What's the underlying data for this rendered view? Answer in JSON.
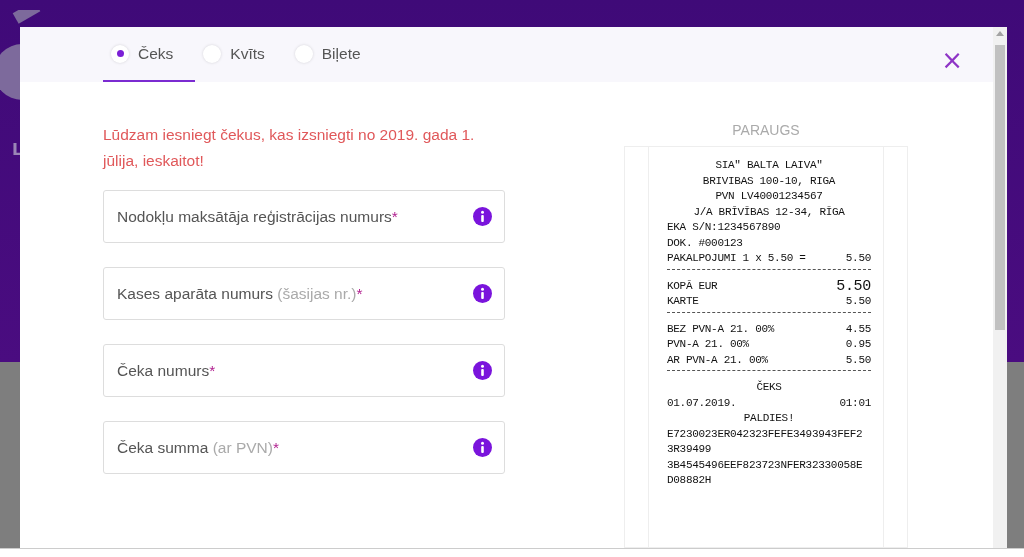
{
  "background_text": "L",
  "tabs": [
    {
      "label": "Čeks",
      "selected": true
    },
    {
      "label": "Kvīts",
      "selected": false
    },
    {
      "label": "Biļete",
      "selected": false
    }
  ],
  "close": "×",
  "notice": "Lūdzam iesniegt čekus, kas izsniegti no 2019. gada 1. jūlija, ieskaitot!",
  "fields": [
    {
      "label": "Nodokļu maksātāja reģistrācijas numurs",
      "required_mark": "*"
    },
    {
      "label": "Kases aparāta numurs",
      "hint": "(šasijas nr.)",
      "required_mark": "*"
    },
    {
      "label": "Čeka numurs",
      "required_mark": "*"
    },
    {
      "label": "Čeka summa",
      "hint": "(ar PVN)",
      "required_mark": "*"
    }
  ],
  "sample": {
    "title": "PARAUGS",
    "lines": [
      {
        "kind": "center",
        "text": "SIA\" BALTA LAIVA\""
      },
      {
        "kind": "center",
        "text": "BRIVIBAS 100-10, RIGA"
      },
      {
        "kind": "center",
        "text": "PVN LV40001234567"
      },
      {
        "kind": "center",
        "text": "J/A BRĪVĪBAS 12-34, RĪGA"
      },
      {
        "kind": "left",
        "text": "EKA S/N:1234567890"
      },
      {
        "kind": "left",
        "text": "DOK. #000123"
      },
      {
        "kind": "split",
        "text": "PAKALPOJUMI 1 x 5.50 =",
        "value": "5.50"
      },
      {
        "kind": "separator"
      },
      {
        "kind": "total",
        "text": "KOPĀ EUR",
        "value": "5.50"
      },
      {
        "kind": "split",
        "text": "KARTE",
        "value": "5.50"
      },
      {
        "kind": "separator"
      },
      {
        "kind": "split",
        "text": "BEZ PVN-A 21. 00%",
        "value": "4.55"
      },
      {
        "kind": "split",
        "text": "PVN-A 21. 00%",
        "value": "0.95"
      },
      {
        "kind": "split",
        "text": "AR PVN-A 21. 00%",
        "value": "5.50"
      },
      {
        "kind": "separator"
      },
      {
        "kind": "center",
        "text": "ČEKS"
      },
      {
        "kind": "split",
        "text": "01.07.2019.",
        "value": "01:01"
      },
      {
        "kind": "center",
        "text": "PALDIES!"
      },
      {
        "kind": "left",
        "text": "E7230023ER042323FEFE3493943FEF2"
      },
      {
        "kind": "left",
        "text": "3R39499"
      },
      {
        "kind": "left",
        "text": "3B4545496EEF823723NFER32330058E"
      },
      {
        "kind": "left",
        "text": "D08882H"
      }
    ]
  }
}
